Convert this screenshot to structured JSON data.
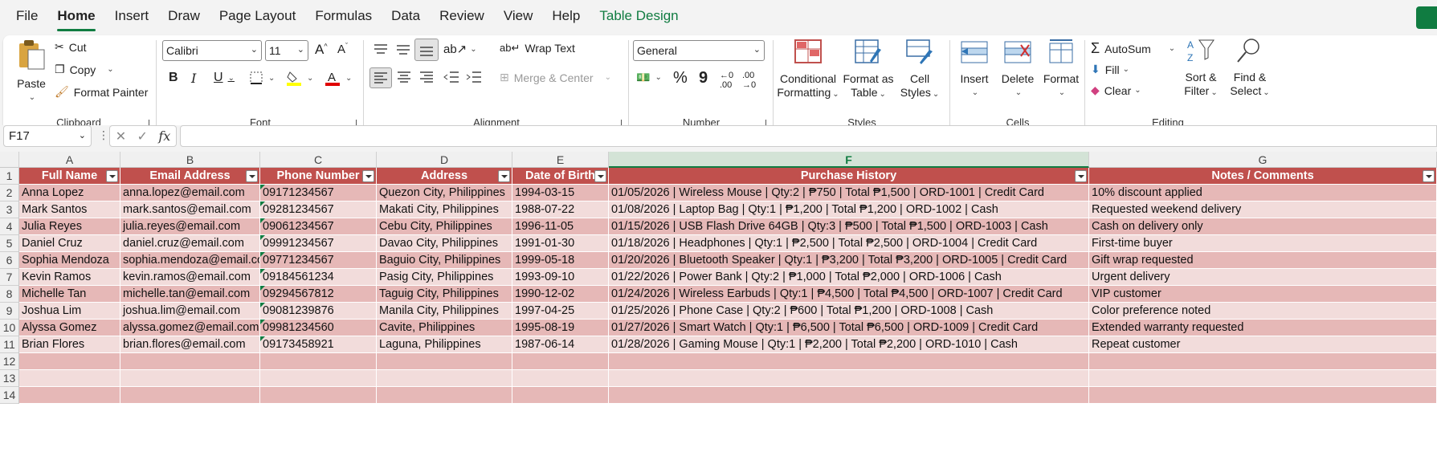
{
  "menu": {
    "items": [
      "File",
      "Home",
      "Insert",
      "Draw",
      "Page Layout",
      "Formulas",
      "Data",
      "Review",
      "View",
      "Help",
      "Table Design"
    ],
    "active": "Home"
  },
  "clipboard": {
    "paste": "Paste",
    "cut": "Cut",
    "copy": "Copy",
    "format_painter": "Format Painter",
    "label": "Clipboard"
  },
  "font": {
    "name": "Calibri",
    "size": "11",
    "bold": "B",
    "italic": "I",
    "underline": "U",
    "label": "Font"
  },
  "alignment": {
    "wrap_text": "Wrap Text",
    "merge_center": "Merge & Center",
    "label": "Alignment"
  },
  "number": {
    "format": "General",
    "percent": "%",
    "comma": "9",
    "label": "Number"
  },
  "styles": {
    "conditional": [
      "Conditional",
      "Formatting"
    ],
    "format_table": [
      "Format as",
      "Table"
    ],
    "cell_styles": [
      "Cell",
      "Styles"
    ],
    "label": "Styles"
  },
  "cells": {
    "insert": "Insert",
    "delete": "Delete",
    "format": "Format",
    "label": "Cells"
  },
  "editing": {
    "autosum": "AutoSum",
    "fill": "Fill",
    "clear": "Clear",
    "sort_filter": [
      "Sort &",
      "Filter"
    ],
    "find_select": [
      "Find &",
      "Select"
    ],
    "label": "Editing"
  },
  "formula_bar": {
    "name_box": "F17",
    "fx": "fx",
    "value": ""
  },
  "colors": {
    "accent": "#107c41",
    "header_fill": "#c0504d",
    "band_dark": "#e6b8b7",
    "band_light": "#f2dcdb"
  },
  "sheet": {
    "columns": [
      "A",
      "B",
      "C",
      "D",
      "E",
      "F",
      "G"
    ],
    "selected_column": "F",
    "row_numbers": [
      "1",
      "2",
      "3",
      "4",
      "5",
      "6",
      "7",
      "8",
      "9",
      "10",
      "11",
      "12",
      "13",
      "14"
    ],
    "headers": [
      "Full Name",
      "Email Address",
      "Phone Number",
      "Address",
      "Date of Birth",
      "Purchase History",
      "Notes / Comments"
    ],
    "rows": [
      [
        "Anna Lopez",
        "anna.lopez@email.com",
        "09171234567",
        "Quezon City, Philippines",
        "1994-03-15",
        "01/05/2026 | Wireless Mouse | Qty:2 | ₱750 | Total ₱1,500 | ORD-1001 | Credit Card",
        "10% discount applied"
      ],
      [
        "Mark Santos",
        "mark.santos@email.com",
        "09281234567",
        "Makati City, Philippines",
        "1988-07-22",
        "01/08/2026 | Laptop Bag | Qty:1 | ₱1,200 | Total ₱1,200 | ORD-1002 | Cash",
        "Requested weekend delivery"
      ],
      [
        "Julia Reyes",
        "julia.reyes@email.com",
        "09061234567",
        "Cebu City, Philippines",
        "1996-11-05",
        "01/15/2026 | USB Flash Drive 64GB | Qty:3 | ₱500 | Total ₱1,500 | ORD-1003 | Cash",
        "Cash on delivery only"
      ],
      [
        "Daniel Cruz",
        "daniel.cruz@email.com",
        "09991234567",
        "Davao City, Philippines",
        "1991-01-30",
        "01/18/2026 | Headphones | Qty:1 | ₱2,500 | Total ₱2,500 | ORD-1004 | Credit Card",
        "First-time buyer"
      ],
      [
        "Sophia Mendoza",
        "sophia.mendoza@email.co",
        "09771234567",
        "Baguio City, Philippines",
        "1999-05-18",
        "01/20/2026 | Bluetooth Speaker | Qty:1 | ₱3,200 | Total ₱3,200 | ORD-1005 | Credit Card",
        "Gift wrap requested"
      ],
      [
        "Kevin Ramos",
        "kevin.ramos@email.com",
        "09184561234",
        "Pasig City, Philippines",
        "1993-09-10",
        "01/22/2026 | Power Bank | Qty:2 | ₱1,000 | Total ₱2,000 | ORD-1006 | Cash",
        "Urgent delivery"
      ],
      [
        "Michelle Tan",
        "michelle.tan@email.com",
        "09294567812",
        "Taguig City, Philippines",
        "1990-12-02",
        "01/24/2026 | Wireless Earbuds | Qty:1 | ₱4,500 | Total ₱4,500 | ORD-1007 | Credit Card",
        "VIP customer"
      ],
      [
        "Joshua Lim",
        "joshua.lim@email.com",
        "09081239876",
        "Manila City, Philippines",
        "1997-04-25",
        "01/25/2026 | Phone Case | Qty:2 | ₱600 | Total ₱1,200 | ORD-1008 | Cash",
        "Color preference noted"
      ],
      [
        "Alyssa Gomez",
        "alyssa.gomez@email.com",
        "09981234560",
        "Cavite, Philippines",
        "1995-08-19",
        "01/27/2026 | Smart Watch | Qty:1 | ₱6,500 | Total ₱6,500 | ORD-1009 | Credit Card",
        "Extended warranty requested"
      ],
      [
        "Brian Flores",
        "brian.flores@email.com",
        "09173458921",
        "Laguna, Philippines",
        "1987-06-14",
        "01/28/2026 | Gaming Mouse | Qty:1 | ₱2,200 | Total ₱2,200 | ORD-1010 | Cash",
        "Repeat customer"
      ]
    ]
  }
}
